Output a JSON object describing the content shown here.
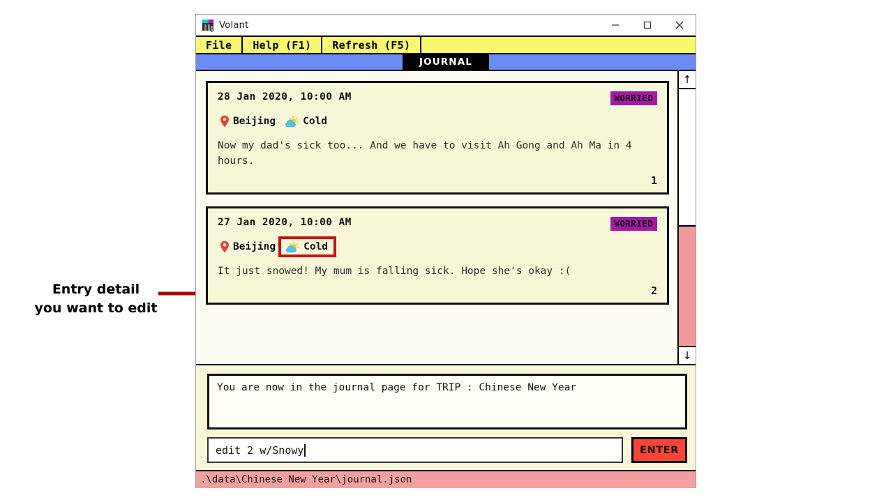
{
  "annotation": {
    "text": "Entry detail\nyou want to edit",
    "arrow_color": "#b00000"
  },
  "window": {
    "title": "Volant",
    "icon": "app-icon",
    "controls": {
      "minimize": "minimize-icon",
      "maximize": "maximize-icon",
      "close": "close-icon"
    }
  },
  "menubar": {
    "items": [
      {
        "label": "File"
      },
      {
        "label": "Help (F1)"
      },
      {
        "label": "Refresh (F5)"
      }
    ],
    "background": "#f9f871"
  },
  "tabs": {
    "active": "JOURNAL",
    "strip_color": "#6c8cf5"
  },
  "journal": {
    "entries": [
      {
        "date": "28 Jan 2020,  10:00 AM",
        "mood": "WORRIED",
        "location": "Beijing",
        "weather": "Cold",
        "text": "Now my dad's sick too... And we have to visit Ah Gong and Ah Ma in 4 hours.",
        "number": "1",
        "highlighted": false
      },
      {
        "date": "27 Jan 2020,  10:00 AM",
        "mood": "WORRIED",
        "location": "Beijing",
        "weather": "Cold",
        "text": "It just snowed! My mum is falling sick. Hope she's okay :(",
        "number": "2",
        "highlighted": true
      }
    ],
    "mood_color": "#a617a6",
    "card_color": "#f8f8d8"
  },
  "scrollbar": {
    "up_arrow": "↑",
    "down_arrow": "↓",
    "thumb_color": "#f19a9a"
  },
  "message": {
    "text": "You are now in the journal page for TRIP : Chinese New Year"
  },
  "input": {
    "value": "edit 2 w/Snowy",
    "placeholder": "",
    "enter_label": "ENTER",
    "enter_color": "#ff4433"
  },
  "statusbar": {
    "path": ".\\data\\Chinese New Year\\journal.json",
    "background": "#f4a0a0"
  }
}
